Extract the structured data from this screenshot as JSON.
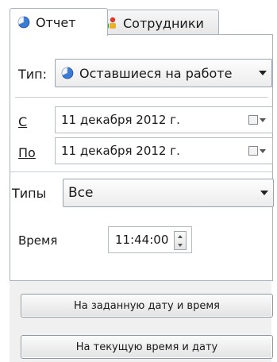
{
  "tabs": [
    {
      "label": "Отчет",
      "icon": "pie-chart-icon"
    },
    {
      "label": "Сотрудники",
      "icon": "users-icon"
    }
  ],
  "filters": {
    "type_label": "Тип:",
    "type_value": "Оставшиеся на работе",
    "from_label": "С",
    "from_value": "11 декабря  2012 г.",
    "to_label": "По",
    "to_value": "11 декабря  2012 г.",
    "types_label": "Типы",
    "types_value": "Все",
    "time_label": "Время",
    "time_value": "11:44:00"
  },
  "buttons": {
    "set_datetime": "На заданную дату и время",
    "current_datetime": "На текущую время и дату"
  },
  "colors": {
    "border": "#a9b3bd",
    "icon_blue": "#3a7bd5",
    "icon_green": "#2e9d3a",
    "icon_red": "#d23b2e"
  }
}
